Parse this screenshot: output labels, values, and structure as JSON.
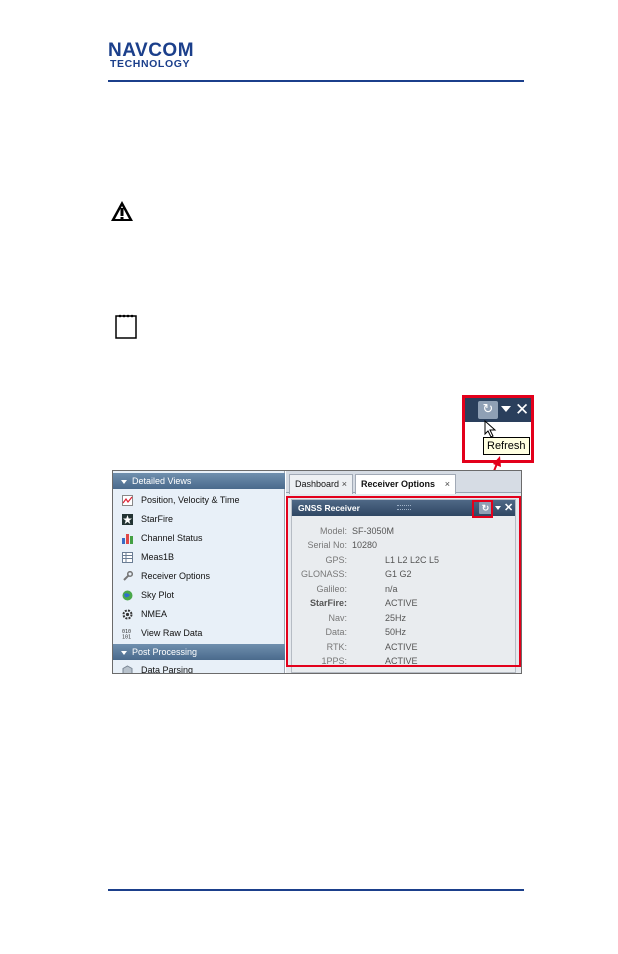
{
  "logo": {
    "line1": "NAVCOM",
    "line2": "TECHNOLOGY"
  },
  "colors": {
    "brand": "#1b3f8b",
    "highlight": "#e3001b",
    "panel_title": "#2f4763"
  },
  "zoom_callout": {
    "tooltip": "Refresh",
    "refresh_icon": "refresh-icon",
    "caret_icon": "chevron-down-icon",
    "close_icon": "close-icon"
  },
  "sidebar": {
    "sections": [
      {
        "label": "Detailed Views"
      },
      {
        "label": "Post Processing"
      }
    ],
    "items": [
      {
        "label": "Position, Velocity & Time",
        "icon": "pvt-chart-icon"
      },
      {
        "label": "StarFire",
        "icon": "starfire-icon"
      },
      {
        "label": "Channel Status",
        "icon": "bar-chart-icon"
      },
      {
        "label": "Meas1B",
        "icon": "table-icon"
      },
      {
        "label": "Receiver Options",
        "icon": "wrench-icon"
      },
      {
        "label": "Sky Plot",
        "icon": "globe-icon"
      },
      {
        "label": "NMEA",
        "icon": "gear-icon"
      },
      {
        "label": "View Raw Data",
        "icon": "binary-icon"
      },
      {
        "label": "Data Parsing",
        "icon": "box-icon"
      }
    ]
  },
  "tabs": [
    {
      "label": "Dashboard",
      "close": "×"
    },
    {
      "label": "Receiver Options",
      "close": "×"
    }
  ],
  "panel": {
    "title": "GNSS Receiver",
    "rows": [
      {
        "label": "Model:",
        "value": "SF-3050M"
      },
      {
        "label": "Serial No:",
        "value": "10280"
      },
      {
        "label": "GPS:",
        "value": "L1 L2 L2C L5"
      },
      {
        "label": "GLONASS:",
        "value": "G1 G2"
      },
      {
        "label": "Galileo:",
        "value": "n/a"
      },
      {
        "label": "StarFire:",
        "value": "ACTIVE"
      },
      {
        "label": "Nav:",
        "value": "25Hz"
      },
      {
        "label": "Data:",
        "value": "50Hz"
      },
      {
        "label": "RTK:",
        "value": "ACTIVE"
      },
      {
        "label": "1PPS:",
        "value": "ACTIVE"
      }
    ]
  }
}
